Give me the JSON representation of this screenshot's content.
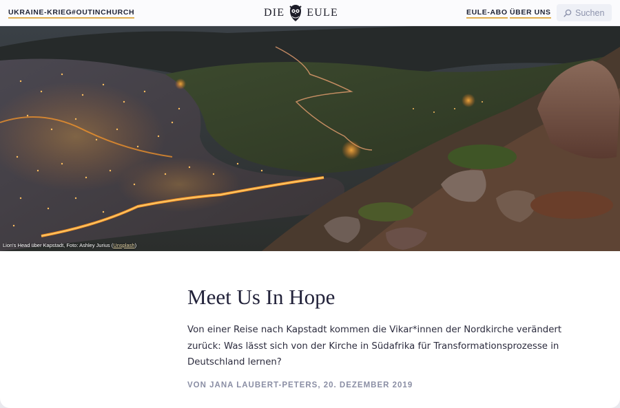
{
  "header": {
    "nav_left": [
      {
        "label": "UKRAINE-KRIEG"
      },
      {
        "label": "#OUTINCHURCH"
      }
    ],
    "logo": {
      "left_word": "DIE",
      "right_word": "EULE",
      "icon": "owl-icon"
    },
    "nav_right": [
      {
        "label": "EULE-ABO"
      },
      {
        "label": "ÜBER UNS"
      }
    ],
    "search": {
      "label": "Suchen",
      "icon": "search-icon"
    }
  },
  "hero": {
    "caption_text": "Lion's Head über Kapstadt, Foto: Ashley Jurius (",
    "caption_link": "Unsplash",
    "caption_end": ")"
  },
  "article": {
    "title": "Meet Us In Hope",
    "lead": "Von einer Reise nach Kapstadt kommen die Vikar*innen der Nordkirche verändert zurück: Was lässt sich von der Kirche in Südafrika für Transformationsprozesse in Deutschland lernen?",
    "byline": "VON JANA LAUBERT-PETERS, 20. DEZEMBER 2019"
  },
  "colors": {
    "accent_underline": "#e0ad4e",
    "title": "#22223a",
    "byline": "#8a8ea4",
    "search_bg": "#eef0f6"
  }
}
